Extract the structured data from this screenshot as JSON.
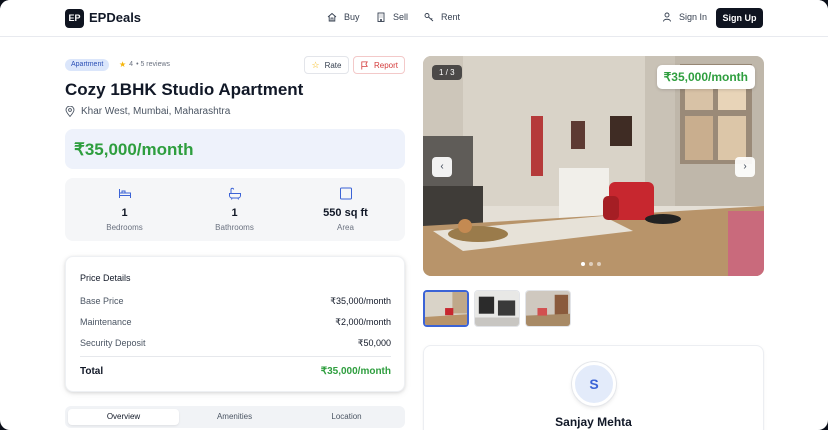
{
  "brand": {
    "logo_text": "EP",
    "name": "EPDeals"
  },
  "nav": {
    "items": [
      {
        "label": "Buy",
        "icon": "home-icon"
      },
      {
        "label": "Sell",
        "icon": "building-icon"
      },
      {
        "label": "Rent",
        "icon": "key-icon"
      }
    ],
    "sign_in": "Sign In",
    "sign_up": "Sign Up"
  },
  "property": {
    "type_badge": "Apartment",
    "rating": "4",
    "reviews": "• 5 reviews",
    "rate_label": "Rate",
    "report_label": "Report",
    "title": "Cozy 1BHK Studio Apartment",
    "location": "Khar West, Mumbai, Maharashtra",
    "price": "₹35,000/month"
  },
  "stats": [
    {
      "value": "1",
      "label": "Bedrooms",
      "icon": "bed-icon"
    },
    {
      "value": "1",
      "label": "Bathrooms",
      "icon": "bath-icon"
    },
    {
      "value": "550 sq ft",
      "label": "Area",
      "icon": "area-square-icon"
    }
  ],
  "price_details": {
    "title": "Price Details",
    "rows": [
      {
        "label": "Base Price",
        "value": "₹35,000/month"
      },
      {
        "label": "Maintenance",
        "value": "₹2,000/month"
      },
      {
        "label": "Security Deposit",
        "value": "₹50,000"
      }
    ],
    "total_label": "Total",
    "total_value": "₹35,000/month"
  },
  "tabs": [
    "Overview",
    "Amenities",
    "Location"
  ],
  "gallery": {
    "counter": "1 / 3",
    "price": "₹35,000/month",
    "prev": "‹",
    "next": "›"
  },
  "agent": {
    "initial": "S",
    "name": "Sanjay Mehta"
  },
  "colors": {
    "accent": "#0f1420",
    "price_green": "#2e9e3e",
    "badge_blue": "#2b4fb5",
    "report_red": "#d43b3b"
  }
}
